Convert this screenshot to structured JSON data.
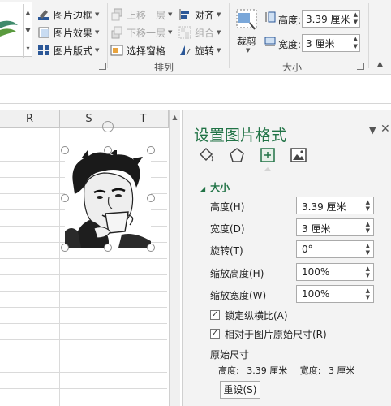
{
  "ribbon": {
    "picture_styles": {
      "border_label": "图片边框",
      "effects_label": "图片效果",
      "layout_label": "图片版式"
    },
    "arrange": {
      "bring_forward_label": "上移一层",
      "send_backward_label": "下移一层",
      "selection_pane_label": "选择窗格",
      "align_label": "对齐",
      "group_label": "组合",
      "rotate_label": "旋转",
      "group_title": "排列"
    },
    "crop_label": "裁剪",
    "size": {
      "height_label": "高度:",
      "height_value": "3.39 厘米",
      "width_label": "宽度:",
      "width_value": "3 厘米",
      "group_title": "大小"
    }
  },
  "grid": {
    "columns": [
      "R",
      "S",
      "T"
    ]
  },
  "pane": {
    "title": "设置图片格式",
    "section_title": "大小",
    "rows": [
      {
        "label": "高度(H)",
        "value": "3.39 厘米"
      },
      {
        "label": "宽度(D)",
        "value": "3 厘米"
      },
      {
        "label": "旋转(T)",
        "value": "0°"
      },
      {
        "label": "缩放高度(H)",
        "value": "100%"
      },
      {
        "label": "缩放宽度(W)",
        "value": "100%"
      }
    ],
    "lock_aspect_label": "锁定纵横比(A)",
    "relative_label": "相对于图片原始尺寸(R)",
    "original_size_title": "原始尺寸",
    "original_height_label": "高度:",
    "original_height_value": "3.39 厘米",
    "original_width_label": "宽度:",
    "original_width_value": "3 厘米",
    "reset_label": "重设(S)"
  },
  "colors": {
    "accent": "#217346",
    "ribbon_bg": "#f3f3f3"
  }
}
